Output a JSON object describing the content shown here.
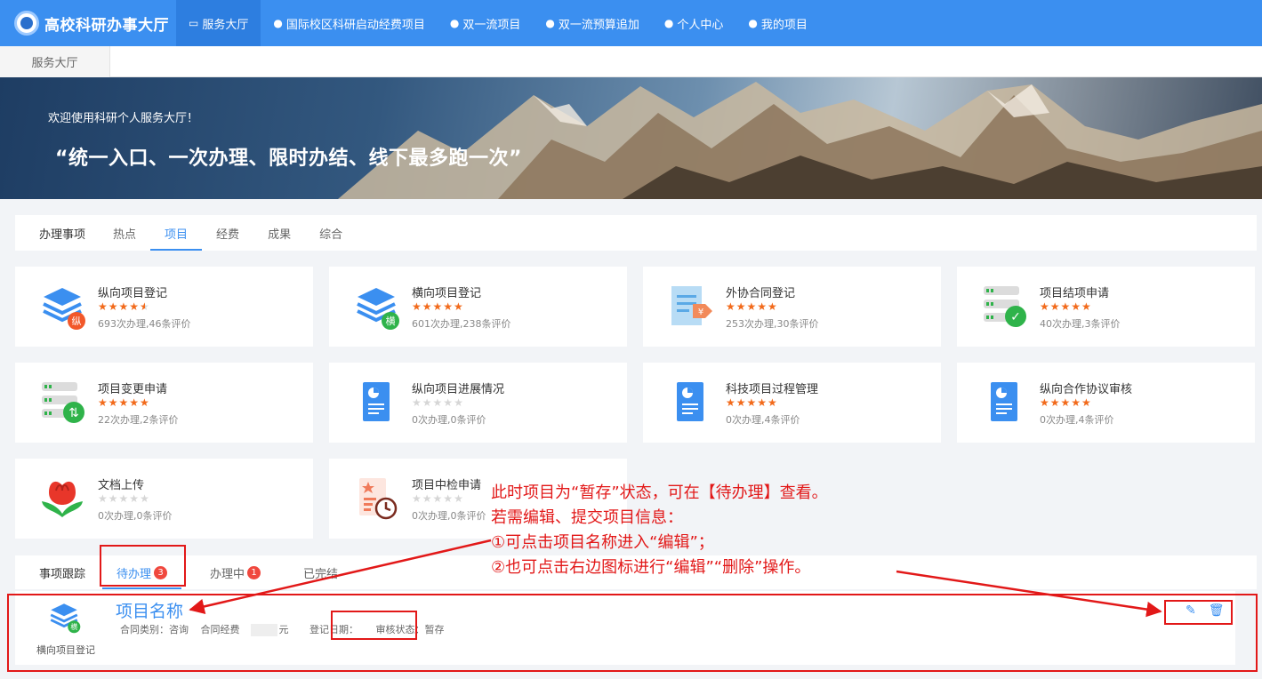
{
  "app": {
    "title": "高校科研办事大厅"
  },
  "nav": [
    {
      "label": "服务大厅",
      "icon": "monitor-icon",
      "active": true
    },
    {
      "label": "国际校区科研启动经费项目",
      "icon": "user-icon"
    },
    {
      "label": "双一流项目",
      "icon": "user-icon"
    },
    {
      "label": "双一流预算追加",
      "icon": "user-icon"
    },
    {
      "label": "个人中心",
      "icon": "user-icon"
    },
    {
      "label": "我的项目",
      "icon": "user-icon"
    }
  ],
  "breadcrumb": {
    "current": "服务大厅"
  },
  "banner": {
    "subtitle": "欢迎使用科研个人服务大厅！",
    "slogan": "“统一入口、一次办理、限时办结、线下最多跑一次”"
  },
  "services_tabs": {
    "label": "办理事项",
    "tabs": [
      "热点",
      "项目",
      "经费",
      "成果",
      "综合"
    ],
    "active": "项目"
  },
  "cards": [
    {
      "name": "纵向项目登记",
      "rating": 4.5,
      "stats": "693次办理,46条评价",
      "icon": "layers-icon",
      "badge": "纵",
      "badge_color": "#f2582a"
    },
    {
      "name": "横向项目登记",
      "rating": 5,
      "stats": "601次办理,238条评价",
      "icon": "layers-icon",
      "badge": "横",
      "badge_color": "#2fb34a"
    },
    {
      "name": "外协合同登记",
      "rating": 5,
      "stats": "253次办理,30条评价",
      "icon": "contract-icon"
    },
    {
      "name": "项目结项申请",
      "rating": 5,
      "stats": "40次办理,3条评价",
      "icon": "server-check-icon"
    },
    {
      "name": "项目变更申请",
      "rating": 5,
      "stats": "22次办理,2条评价",
      "icon": "server-sync-icon"
    },
    {
      "name": "纵向项目进展情况",
      "rating": 0,
      "stats": "0次办理,0条评价",
      "icon": "report-icon"
    },
    {
      "name": "科技项目过程管理",
      "rating": 5,
      "stats": "0次办理,4条评价",
      "icon": "report-icon"
    },
    {
      "name": "纵向合作协议审核",
      "rating": 5,
      "stats": "0次办理,4条评价",
      "icon": "report-icon"
    },
    {
      "name": "文档上传",
      "rating": 0,
      "stats": "0次办理,0条评价",
      "icon": "flower-icon"
    },
    {
      "name": "项目中检申请",
      "rating": 0,
      "stats": "0次办理,0条评价",
      "icon": "doc-clock-icon"
    }
  ],
  "tracking": {
    "label": "事项跟踪",
    "tabs": [
      {
        "label": "待办理",
        "badge": "3",
        "active": true
      },
      {
        "label": "办理中",
        "badge": "1"
      },
      {
        "label": "已完结"
      }
    ]
  },
  "item": {
    "category": "横向项目登记",
    "badge": "横",
    "name": "项目名称",
    "contract_type": "合同类别：咨询",
    "contract_fund_label": "合同经费",
    "contract_fund_unit": "元",
    "reg_date": "登记日期：",
    "status": "审核状态：暂存",
    "actions": [
      "edit-icon",
      "trash-icon"
    ]
  },
  "annotation": {
    "lines": [
      "此时项目为“暂存”状态，可在【待办理】查看。",
      "若需编辑、提交项目信息：",
      "①可点击项目名称进入“编辑”；",
      "②也可点击右边图标进行“编辑”“删除”操作。"
    ],
    "color": "#e21818"
  },
  "colors": {
    "primary": "#3b8ff0",
    "star": "#f26a1b",
    "badge": "#f0483e"
  }
}
